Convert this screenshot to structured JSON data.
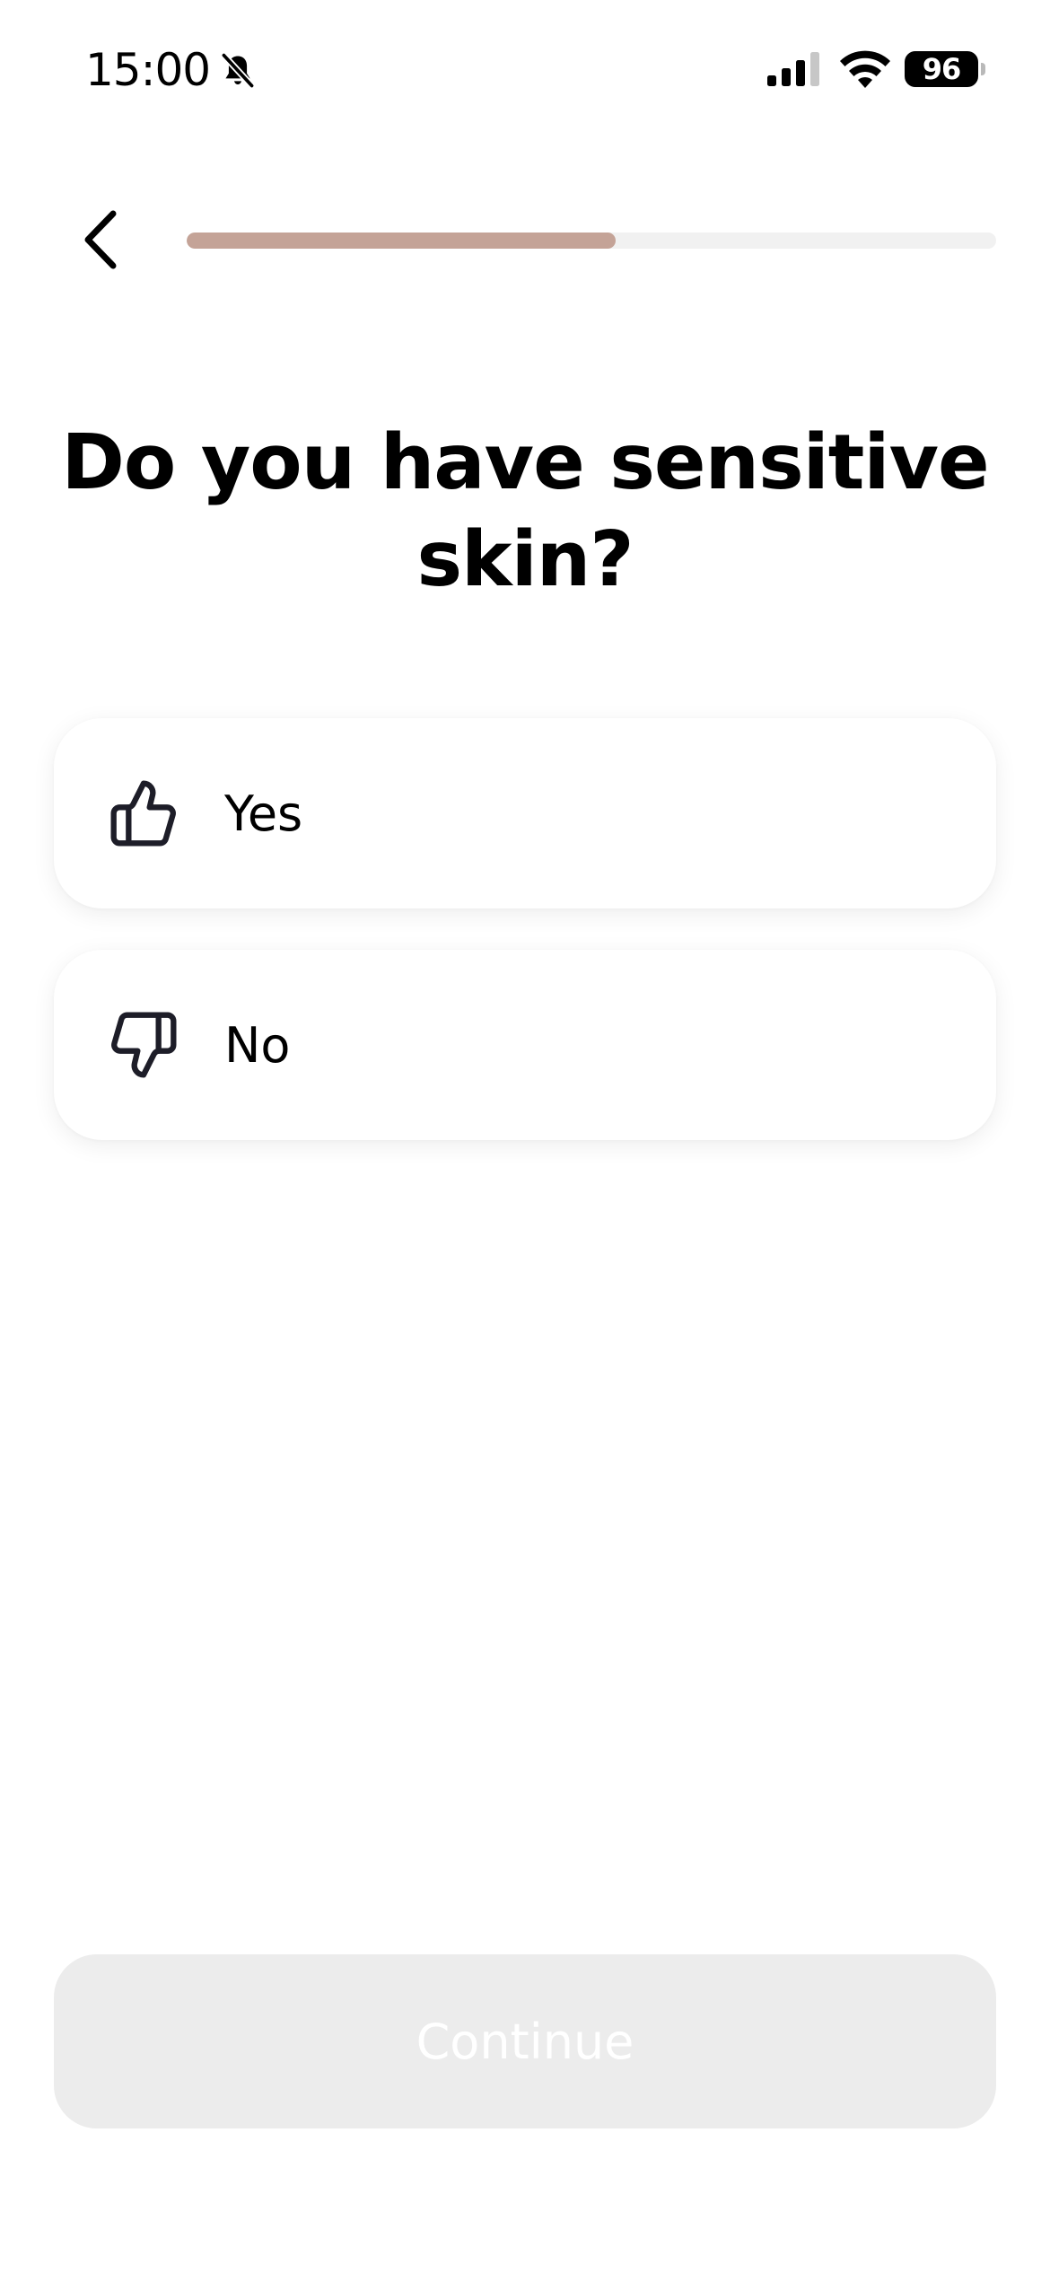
{
  "status_bar": {
    "time": "15:00",
    "silent_icon": "bell-off-icon",
    "signal_icon": "cellular-signal-icon",
    "wifi_icon": "wifi-icon",
    "battery_level": "96"
  },
  "header": {
    "back_icon": "chevron-left-icon",
    "progress_fraction": 0.53
  },
  "question": {
    "title": "Do you have sensitive skin?"
  },
  "options": [
    {
      "label": "Yes",
      "icon": "thumbs-up-icon"
    },
    {
      "label": "No",
      "icon": "thumbs-down-icon"
    }
  ],
  "footer": {
    "continue_label": "Continue"
  },
  "colors": {
    "progress_fill": "#c4a397",
    "progress_track": "#f1f1f1",
    "continue_disabled_bg": "#ececec",
    "continue_disabled_text": "#ffffff"
  }
}
